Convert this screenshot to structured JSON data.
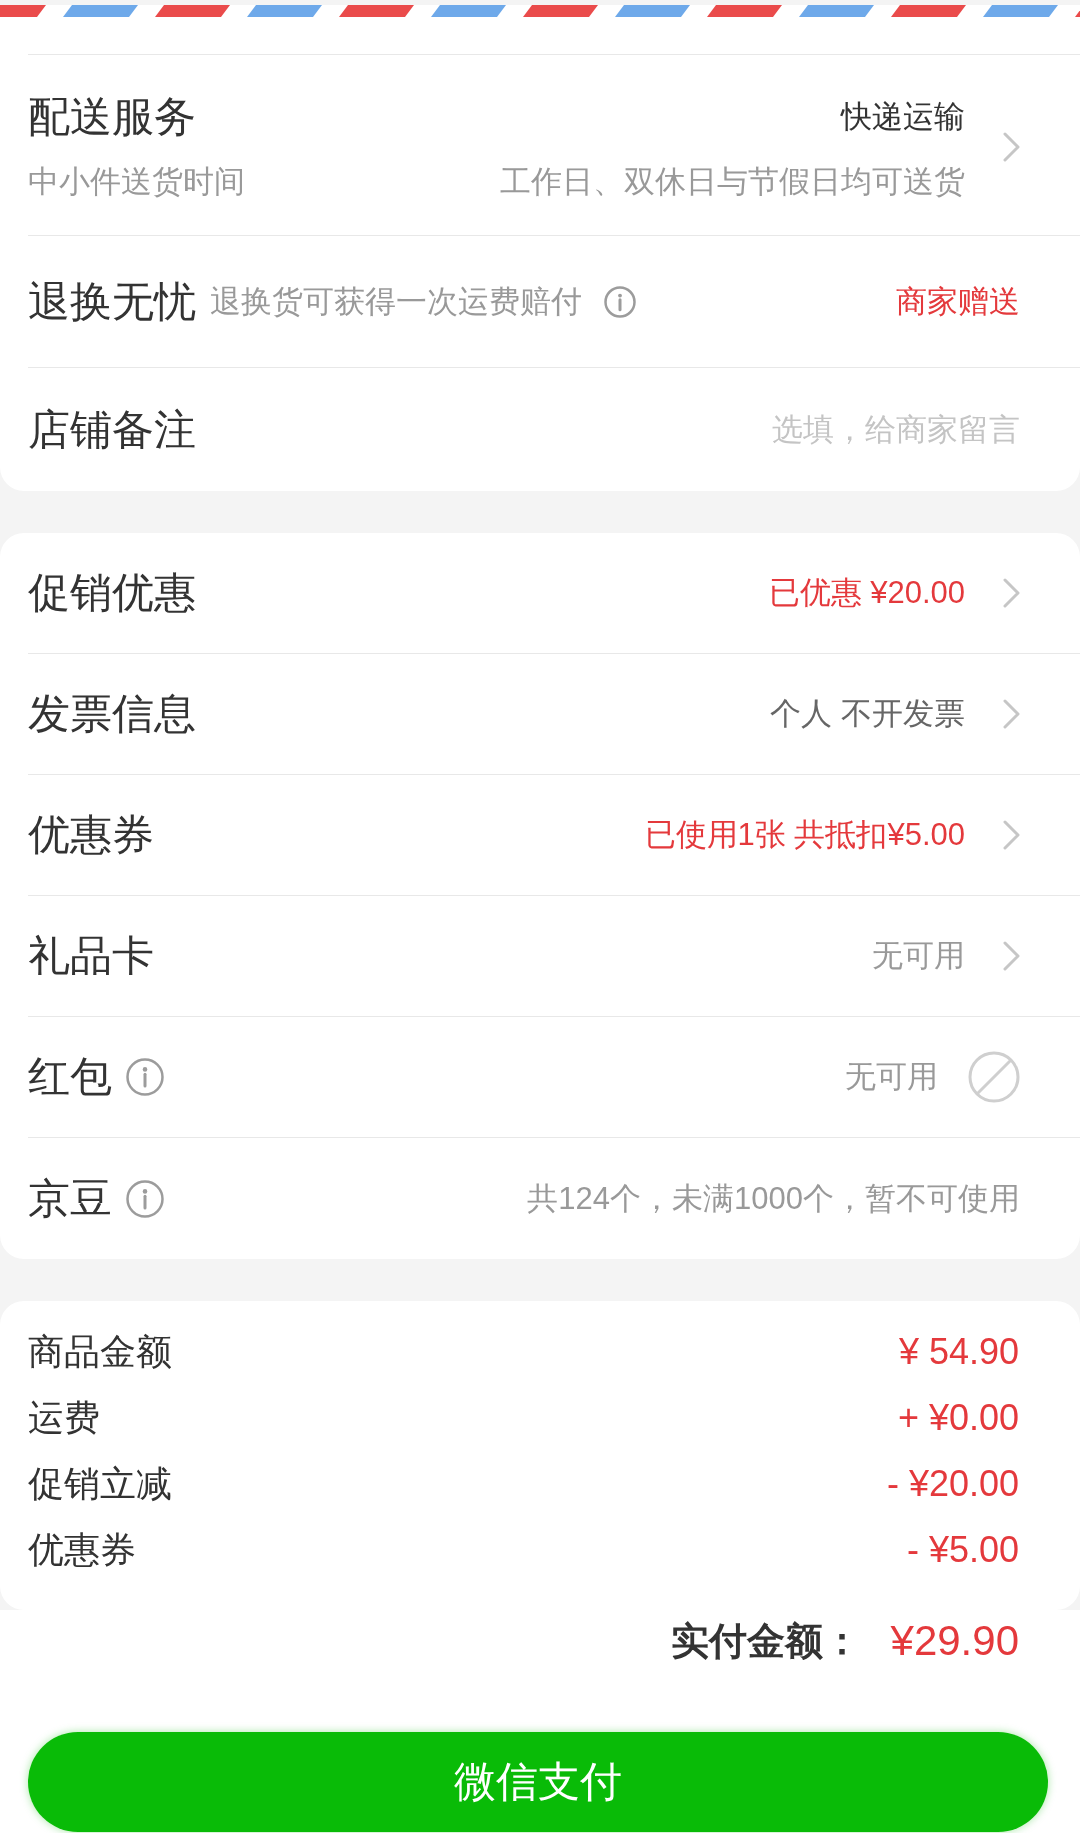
{
  "order_options": [
    {
      "kind": "delivery",
      "label": "配送服务",
      "value": "快递运输",
      "note": "中小件送货时间",
      "detail": "工作日、双休日与节假日均可送货",
      "highlight": false,
      "info": false
    },
    {
      "kind": "service",
      "label": "退换无忧",
      "note": "退换货可获得一次运费赔付",
      "info": true,
      "value": "商家赠送",
      "highlight": true
    },
    {
      "kind": "remark",
      "label": "店铺备注",
      "placeholder": "选填，给商家留言",
      "info": false
    }
  ],
  "discounts": [
    {
      "kind": "link",
      "label": "促销优惠",
      "info": false,
      "value": "已优惠 ¥20.00",
      "highlight": true,
      "disabled": false
    },
    {
      "kind": "link",
      "label": "发票信息",
      "info": false,
      "value": "个人 不开发票",
      "highlight": false,
      "disabled": false
    },
    {
      "kind": "link",
      "label": "优惠券",
      "info": false,
      "value": "已使用1张 共抵扣¥5.00",
      "highlight": true,
      "disabled": false
    },
    {
      "kind": "link",
      "label": "礼品卡",
      "info": false,
      "value": "无可用",
      "highlight": false,
      "disabled": true
    },
    {
      "kind": "toggle",
      "label": "红包",
      "info": true,
      "value": "无可用",
      "highlight": false,
      "disabled": true
    },
    {
      "kind": "plain",
      "label": "京豆",
      "info": true,
      "value": "共124个，未满1000个，暂不可使用",
      "highlight": false,
      "disabled": true
    }
  ],
  "price_summary": [
    {
      "label": "商品金额",
      "amount": "¥ 54.90"
    },
    {
      "label": "运费",
      "amount": "+ ¥0.00"
    },
    {
      "label": "促销立减",
      "amount": "- ¥20.00"
    },
    {
      "label": "优惠券",
      "amount": "- ¥5.00"
    }
  ],
  "total": {
    "label": "实付金额：",
    "amount": "¥29.90"
  },
  "pay_button": {
    "label": "微信支付"
  }
}
